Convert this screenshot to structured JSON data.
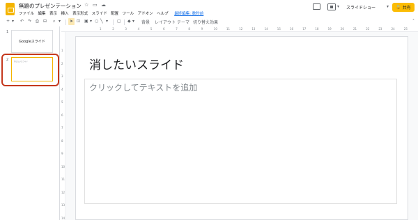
{
  "header": {
    "doc_title": "無題のプレゼンテーション",
    "menu": [
      "ファイル",
      "編集",
      "表示",
      "挿入",
      "表示形式",
      "スライド",
      "配置",
      "ツール",
      "アドオン",
      "ヘルプ"
    ],
    "last_edit": "最終編集: 数秒前",
    "slideshow_label": "スライドショー",
    "share_label": "共有",
    "share_color": "#fbbc04"
  },
  "toolbar": {
    "background_label": "背景",
    "layout_label": "レイアウト",
    "theme_label": "テーマ",
    "transition_label": "切り替え効果"
  },
  "filmstrip": {
    "slides": [
      {
        "number": "1",
        "thumb_text": "Googleスライド"
      },
      {
        "number": "2",
        "thumb_text": "消したいスライド"
      }
    ],
    "highlight_color": "#c5381d"
  },
  "ruler": {
    "h_ticks": [
      "1",
      "2",
      "3",
      "4",
      "5",
      "6",
      "7",
      "8",
      "9",
      "10",
      "11",
      "12",
      "13",
      "14",
      "15",
      "16",
      "17",
      "18",
      "19",
      "20",
      "21",
      "22",
      "23",
      "24",
      "25"
    ],
    "v_ticks": [
      "1",
      "2",
      "3",
      "4",
      "5",
      "6",
      "7",
      "8",
      "9",
      "10",
      "11",
      "12",
      "13",
      "14"
    ]
  },
  "slide": {
    "title": "消したいスライド",
    "body_placeholder": "クリックしてテキストを追加"
  }
}
